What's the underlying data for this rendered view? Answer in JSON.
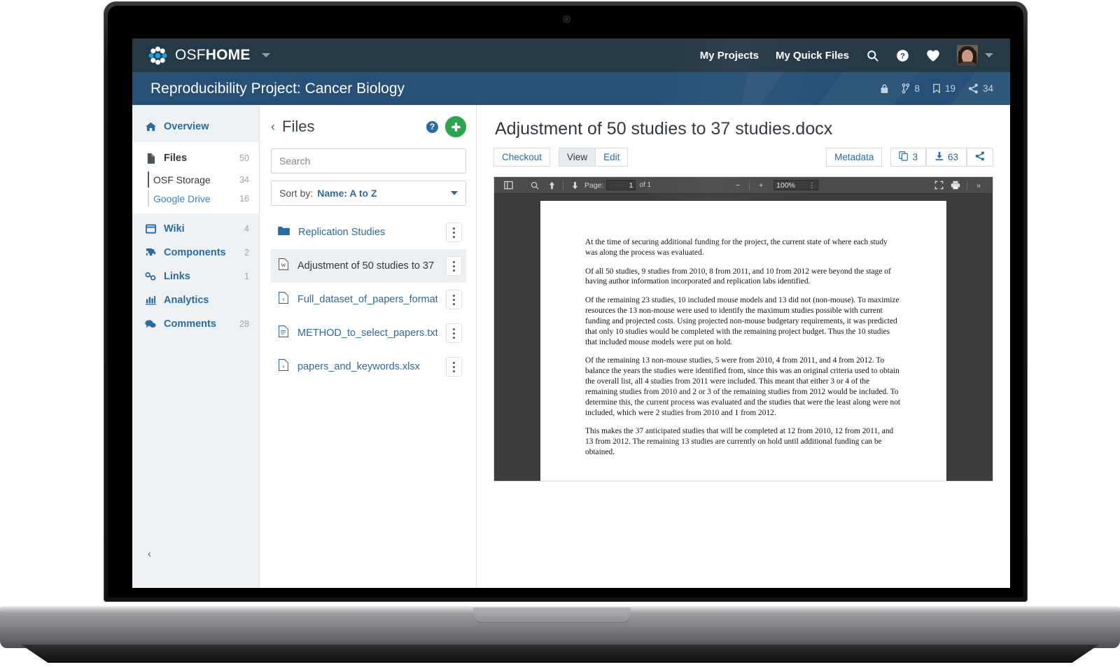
{
  "topnav": {
    "brand_light": "OSF",
    "brand_bold": "HOME",
    "links": [
      {
        "label": "My Projects",
        "name": "my-projects"
      },
      {
        "label": "My Quick Files",
        "name": "my-quick-files"
      }
    ],
    "icons": [
      "search-icon",
      "help-icon",
      "favorites-icon",
      "avatar"
    ]
  },
  "projectbar": {
    "title": "Reproducibility Project: Cancer Biology",
    "meta": [
      {
        "icon": "lock-icon",
        "value": ""
      },
      {
        "icon": "fork-icon",
        "value": "8"
      },
      {
        "icon": "bookmark-icon",
        "value": "19"
      },
      {
        "icon": "share-icon",
        "value": "34"
      }
    ]
  },
  "sidebar": {
    "items": [
      {
        "label": "Overview",
        "count": "",
        "icon": "home-icon"
      },
      {
        "label": "Files",
        "count": "50",
        "icon": "file-icon"
      },
      {
        "label": "Wiki",
        "count": "4",
        "icon": "wiki-icon"
      },
      {
        "label": "Components",
        "count": "2",
        "icon": "components-icon"
      },
      {
        "label": "Links",
        "count": "1",
        "icon": "links-icon"
      },
      {
        "label": "Analytics",
        "count": "",
        "icon": "analytics-icon"
      },
      {
        "label": "Comments",
        "count": "28",
        "icon": "comments-icon"
      }
    ],
    "storage": [
      {
        "label": "OSF Storage",
        "count": "34"
      },
      {
        "label": "Google Drive",
        "count": "16"
      }
    ],
    "collapse_glyph": "‹"
  },
  "files": {
    "back_glyph": "‹",
    "title": "Files",
    "help_glyph": "?",
    "add_glyph": "+",
    "search_placeholder": "Search",
    "search_value": "",
    "sort_lead": "Sort by:",
    "sort_value": "Name: A to Z",
    "rows": [
      {
        "name": "Replication Studies",
        "icon": "folder-icon",
        "selected": false
      },
      {
        "name": "Adjustment of 50 studies to 37",
        "icon": "word-file-icon",
        "selected": true
      },
      {
        "name": "Full_dataset_of_papers_formatt",
        "icon": "excel-file-icon",
        "selected": false
      },
      {
        "name": "METHOD_to_select_papers.txt",
        "icon": "text-file-icon",
        "selected": false
      },
      {
        "name": "papers_and_keywords.xlsx",
        "icon": "excel-file-icon",
        "selected": false
      }
    ]
  },
  "main": {
    "doc_title": "Adjustment of 50 studies to 37 studies.docx",
    "checkout_label": "Checkout",
    "view_label": "View",
    "edit_label": "Edit",
    "metadata_label": "Metadata",
    "version_count": "3",
    "download_count": "63",
    "share_icon": "share-icon"
  },
  "pdf_toolbar": {
    "sidebar_toggle": "sidebar-toggle-icon",
    "find": "search-icon",
    "prev": "arrow-up-icon",
    "next": "arrow-down-icon",
    "page_label": "Page:",
    "page_value": "1",
    "page_total": "of 1",
    "zoom_out": "−",
    "zoom_in": "+",
    "zoom_value": "100%",
    "zoom_caret": "⋮",
    "fullscreen": "fullscreen-icon",
    "print": "print-icon",
    "more": "»"
  },
  "document": {
    "paragraphs": [
      "At the time of securing additional funding for the project, the current state of where each study was along the process was evaluated.",
      "Of all 50 studies, 9 studies from 2010, 8 from 2011, and 10 from 2012 were beyond the stage of having author information incorporated and replication labs identified.",
      "Of the remaining 23 studies, 10 included mouse models and 13 did not (non-mouse). To maximize resources the 13 non-mouse were used to identify the maximum studies possible with current funding and projected costs. Using projected non-mouse budgetary requirements, it was predicted that only 10 studies would be completed with the remaining project budget. Thus the 10 studies that included mouse models were put on hold.",
      "Of the remaining 13 non-mouse studies, 5 were from 2010, 4 from 2011, and 4 from 2012. To balance the years the studies were identified from, since this was an original criteria used to obtain the overall list, all 4 studies from 2011 were included. This meant that either 3 or 4 of the remaining studies from 2010 and 2 or 3 of the remaining studies from 2012 would be included. To determine this, the current process was evaluated and the studies that were the least along were not included, which were 2 studies from 2010 and 1 from 2012.",
      "This makes the 37 anticipated studies that will be completed at 12 from 2010, 12 from 2011, and 13 from 2012. The remaining 13 studies are currently on hold until additional funding can be obtained."
    ]
  },
  "colors": {
    "topnav_bg": "#263947",
    "projectbar_bg": "#265077",
    "link_blue": "#2d6a9f",
    "add_green": "#2da44e",
    "sidebar_bg": "#eef1f3",
    "viewer_bg": "#3d3d3d"
  }
}
